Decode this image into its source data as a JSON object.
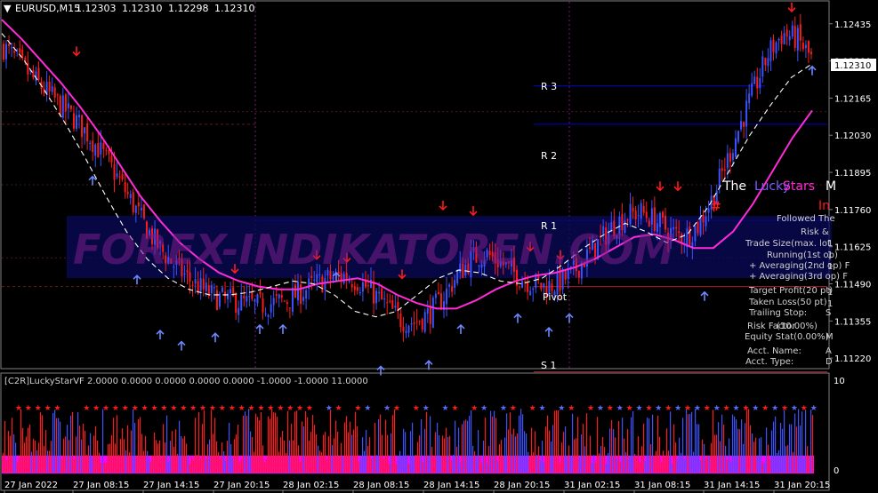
{
  "header": {
    "arrow_glyph": "▼",
    "symbol": "EURUSD,M15",
    "o": "1.12303",
    "h": "1.12310",
    "l": "1.12298",
    "c": "1.12310"
  },
  "watermark": "FOREX-INDIKATOREN.COM",
  "current_price": "1.12310",
  "levels": {
    "r3": "R 3",
    "r2": "R 2",
    "r1": "R 1",
    "pivot": "Pivot",
    "s1": "S 1"
  },
  "panel": {
    "the": "The",
    "lucky": "Lucky",
    "stars": "Stars",
    "m": "M",
    "in": "In",
    "hash": "#",
    "followed": "Followed The",
    "risk": "Risk &",
    "trade_size": "Trade Size(max. lot",
    "running": "Running(1st op)",
    "avg2": "+ Averaging(2nd op) F",
    "avg3": "+ Averaging(3rd op) F",
    "target": "Target Profit(20 pt)",
    "taken": "Taken Loss(50 pt)",
    "trailing": "Trailing Stop:",
    "trailing_val": "S",
    "risk_factor": "Risk Factor",
    "risk_factor_val": "(10.00%)",
    "equity": "Equity Stat(0.00%)",
    "equity_val": "M",
    "acct_name": "Acct. Name:",
    "acct_name_val": "A",
    "acct_type": "Acct. Type:",
    "acct_type_val": "D",
    "right_col": [
      "1",
      "1",
      "1",
      "1",
      "1"
    ]
  },
  "indicator": {
    "label": "[C2R]LuckyStarVF  2.0000 0.0000 0.0000 0.0000 0.0000 -1.0000 -1.0000 11.0000",
    "scale_top": "10",
    "scale_bottom": "0",
    "star": "★",
    "stars_red": [
      1,
      2,
      3,
      4,
      5,
      8,
      9,
      10,
      11,
      12,
      13,
      14,
      15,
      16,
      17,
      18,
      19,
      20,
      21,
      22,
      23,
      24,
      25,
      26,
      27,
      28,
      29,
      30,
      31,
      32,
      33,
      34,
      35,
      36,
      38,
      39,
      40,
      41,
      42,
      43,
      44,
      45,
      46,
      47,
      48,
      50,
      51,
      52,
      53,
      54,
      55,
      56,
      57,
      58,
      59,
      60,
      62,
      63,
      64,
      65,
      66,
      67,
      68,
      69,
      70,
      71,
      72,
      73,
      74,
      75,
      76,
      77,
      78,
      79,
      80,
      81,
      82,
      83
    ],
    "stars_blue": [
      37,
      49,
      61
    ]
  },
  "colors": {
    "bull": "#3a52ff",
    "bear": "#ff1a1a",
    "ma": "#ff2bd8",
    "signal": "#ffffff",
    "grid": "#3a1a1a",
    "level": "#0000aa",
    "hist_base": "#ff00ff"
  },
  "chart_data": {
    "type": "candlestick",
    "symbol": "EURUSD",
    "timeframe": "M15",
    "x_ticks": [
      "27 Jan 2022",
      "27 Jan 08:15",
      "27 Jan 14:15",
      "27 Jan 20:15",
      "28 Jan 02:15",
      "28 Jan 08:15",
      "28 Jan 14:15",
      "28 Jan 20:15",
      "31 Jan 02:15",
      "31 Jan 08:15",
      "31 Jan 14:15",
      "31 Jan 20:15"
    ],
    "y_ticks": [
      1.12435,
      1.123,
      1.12165,
      1.1203,
      1.11895,
      1.1176,
      1.11625,
      1.1149,
      1.11355,
      1.1122
    ],
    "ylim": [
      1.11185,
      1.12515
    ],
    "levels": {
      "R3": 1.1221,
      "R2": 1.1207,
      "R1": 1.1172,
      "Pivot": 1.1148,
      "S1": 1.1117
    },
    "price_path": [
      1.1235,
      1.123,
      1.1224,
      1.1219,
      1.1214,
      1.1209,
      1.1203,
      1.1196,
      1.1188,
      1.1179,
      1.117,
      1.1162,
      1.1156,
      1.1151,
      1.1147,
      1.1144,
      1.1143,
      1.1142,
      1.1141,
      1.1142,
      1.1143,
      1.1146,
      1.1149,
      1.1151,
      1.1152,
      1.115,
      1.1146,
      1.1141,
      1.1136,
      1.1135,
      1.1138,
      1.1144,
      1.1152,
      1.1158,
      1.116,
      1.1157,
      1.1153,
      1.115,
      1.1148,
      1.1149,
      1.1152,
      1.1158,
      1.1164,
      1.117,
      1.1174,
      1.1175,
      1.1172,
      1.1168,
      1.1166,
      1.117,
      1.118,
      1.1193,
      1.1207,
      1.122,
      1.1233,
      1.124,
      1.1238,
      1.1231
    ],
    "ma_slow": [
      1.1245,
      1.1238,
      1.123,
      1.1222,
      1.1213,
      1.1203,
      1.1192,
      1.1181,
      1.1172,
      1.1164,
      1.1158,
      1.1153,
      1.115,
      1.1148,
      1.1147,
      1.1147,
      1.1149,
      1.115,
      1.1151,
      1.1149,
      1.1145,
      1.1142,
      1.114,
      1.114,
      1.1143,
      1.1147,
      1.115,
      1.1152,
      1.1153,
      1.1155,
      1.1158,
      1.1162,
      1.1166,
      1.1167,
      1.1165,
      1.1162,
      1.1162,
      1.1168,
      1.1178,
      1.119,
      1.1202,
      1.1212
    ],
    "ma_signal": [
      1.124,
      1.1231,
      1.122,
      1.1208,
      1.1195,
      1.1181,
      1.1168,
      1.1158,
      1.1151,
      1.1147,
      1.1145,
      1.1145,
      1.1146,
      1.1148,
      1.115,
      1.1149,
      1.1145,
      1.1139,
      1.1137,
      1.1139,
      1.1145,
      1.1151,
      1.1154,
      1.1153,
      1.115,
      1.1149,
      1.1151,
      1.1156,
      1.1162,
      1.1167,
      1.1171,
      1.1168,
      1.1164,
      1.1167,
      1.1177,
      1.119,
      1.1203,
      1.1214,
      1.1224,
      1.1229
    ]
  }
}
